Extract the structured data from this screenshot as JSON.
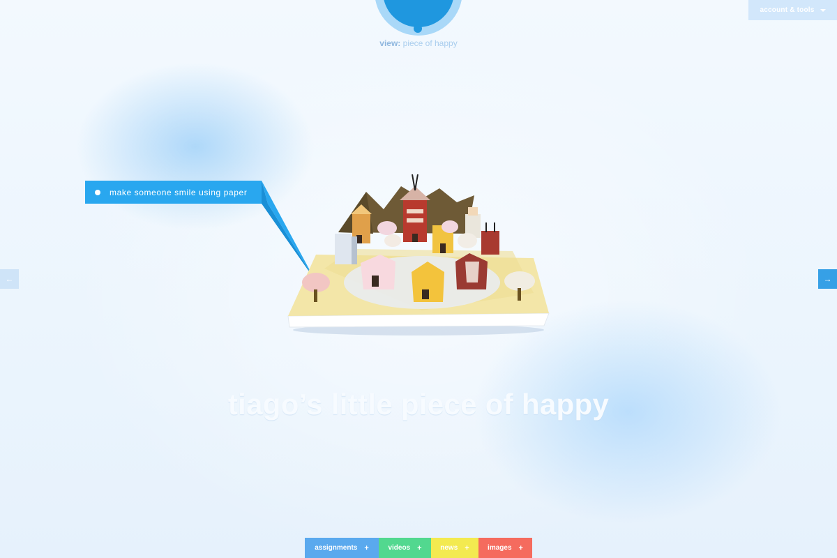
{
  "header": {
    "view_label": "view:",
    "view_value": "piece of happy",
    "account_label": "account & tools"
  },
  "nav": {
    "prev_arrow": "←",
    "next_arrow": "→"
  },
  "callout": {
    "text": "make someone smile using paper"
  },
  "main": {
    "title": "tiago’s little piece of happy"
  },
  "tabs": [
    {
      "label": "assignments",
      "icon": "+"
    },
    {
      "label": "videos",
      "icon": "+"
    },
    {
      "label": "news",
      "icon": "+"
    },
    {
      "label": "images",
      "icon": "+"
    }
  ],
  "colors": {
    "brand_blue": "#1f97df",
    "callout_blue": "#29a7ef",
    "tab_assignments": "#5aa9ee",
    "tab_videos": "#52d88f",
    "tab_news": "#f3ea50",
    "tab_images": "#f56b5e"
  }
}
